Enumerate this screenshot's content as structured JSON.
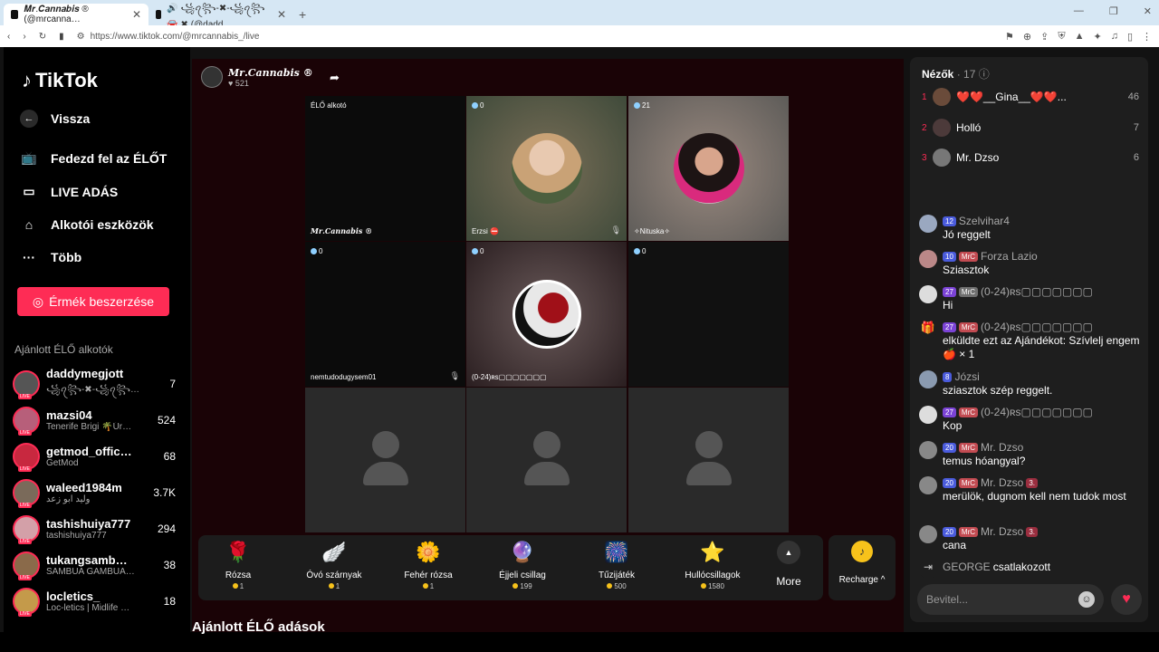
{
  "browser": {
    "tabs": [
      {
        "title": "𝑴𝒓.𝑪𝒂𝒏𝒏𝒂𝒃𝒊𝒔 ® (@mrcanna…",
        "active": true
      },
      {
        "title": "🔊 ꧁ꪖ꧂-✖-꧁ꪖ꧂ 🚘 ✖ (@dadd…",
        "active": false
      }
    ],
    "new_tab": "+",
    "url": "https://www.tiktok.com/@mrcannabis_/live"
  },
  "sidebar": {
    "logo": "TikTok",
    "back": "Vissza",
    "nav": [
      {
        "label": "Fedezd fel az ÉLŐT",
        "icon": "tv-icon"
      },
      {
        "label": "LIVE ADÁS",
        "icon": "camera-icon"
      },
      {
        "label": "Alkotói eszközök",
        "icon": "creator-tools-icon"
      },
      {
        "label": "Több",
        "icon": "more-icon"
      }
    ],
    "coins_button": "Érmék beszerzése",
    "recommended_title": "Ajánlott ÉLŐ alkotók",
    "creators": [
      {
        "name": "daddymegjott",
        "sub": "꧁ꪖ꧂-✖-꧁ꪖ꧂…",
        "count": "7"
      },
      {
        "name": "mazsi04",
        "sub": "Tenerife Brigi 🌴Úr…",
        "count": "524"
      },
      {
        "name": "getmod_offic…",
        "sub": "GetMod",
        "count": "68"
      },
      {
        "name": "waleed1984m",
        "sub": "وليد ابو زعد",
        "count": "3.7K"
      },
      {
        "name": "tashishuiya777",
        "sub": "tashishuiya777",
        "count": "294"
      },
      {
        "name": "tukangsamb…",
        "sub": "SAMBUA GAMBUA…",
        "count": "38"
      },
      {
        "name": "locletics_",
        "sub": "Loc-letics | Midlife …",
        "count": "18"
      }
    ],
    "live_badge": "LIVE"
  },
  "stream": {
    "host_name": "𝑴𝒓.𝑪𝒂𝒏𝒏𝒂𝒃𝒊𝒔 ®",
    "host_likes": "♥ 521",
    "cells": [
      {
        "badge": "ÉLŐ alkotó",
        "tag": "𝑴𝒓.𝑪𝒂𝒏𝒏𝒂𝒃𝒊𝒔 ®"
      },
      {
        "badge": "0",
        "tag": "Erzsi ⛔"
      },
      {
        "badge": "21",
        "tag": "✧Nituska✧"
      },
      {
        "badge": "0",
        "tag": "nemtudodugysem01"
      },
      {
        "badge": "0",
        "tag": "(0-24)ʀs▢▢▢▢▢▢▢"
      },
      {
        "badge": "0",
        "tag": ""
      }
    ],
    "gifts": [
      {
        "name": "Rózsa",
        "price": "1",
        "icon": "🌹"
      },
      {
        "name": "Óvó szárnyak",
        "price": "1",
        "icon": "🪽"
      },
      {
        "name": "Fehér rózsa",
        "price": "1",
        "icon": "🌼"
      },
      {
        "name": "Éjjeli csillag",
        "price": "199",
        "icon": "🔮"
      },
      {
        "name": "Tűzijáték",
        "price": "500",
        "icon": "🎆"
      },
      {
        "name": "Hullócsillagok",
        "price": "1580",
        "icon": "⭐"
      }
    ],
    "more": "More",
    "recharge": "Recharge ^",
    "recommended_live": "Ajánlott ÉLŐ adások"
  },
  "chat": {
    "viewers_title": "Nézők",
    "viewers_count": "· 17",
    "top_viewers": [
      {
        "rank": "1",
        "name": "❤️❤️__Gina__❤️❤️...",
        "points": "46"
      },
      {
        "rank": "2",
        "name": "Holló",
        "points": "7"
      },
      {
        "rank": "3",
        "name": "Mr. Dzso",
        "points": "6"
      }
    ],
    "messages": [
      {
        "level": "12",
        "fan": "",
        "user": "Szelvihar4",
        "rank": "",
        "text": "Jó reggelt"
      },
      {
        "level": "10",
        "fan": "MrC",
        "user": "Forza Lazio",
        "rank": "",
        "text": "Sziasztok"
      },
      {
        "level": "27",
        "fan": "MrC",
        "user": "(0-24)ʀs▢▢▢▢▢▢▢",
        "rank": "",
        "text": "Hi"
      },
      {
        "level": "27",
        "fan": "MrC",
        "user": "(0-24)ʀs▢▢▢▢▢▢▢",
        "rank": "",
        "text": "elküldte ezt az Ajándékot: Szívlelj engem 🍎 × 1"
      },
      {
        "level": "8",
        "fan": "",
        "user": "Józsi",
        "rank": "",
        "text": "sziasztok szép reggelt."
      },
      {
        "level": "27",
        "fan": "MrC",
        "user": "(0-24)ʀs▢▢▢▢▢▢▢",
        "rank": "",
        "text": "Kop"
      },
      {
        "level": "20",
        "fan": "MrC",
        "user": "Mr. Dzso",
        "rank": "",
        "text": "temus hóangyal?"
      },
      {
        "level": "20",
        "fan": "MrC",
        "user": "Mr. Dzso",
        "rank": "3.",
        "text": "merülök, dugnom kell nem tudok most"
      },
      {
        "level": "20",
        "fan": "MrC",
        "user": "Mr. Dzso",
        "rank": "3.",
        "text": "cana"
      }
    ],
    "join_user": "GEORGE",
    "join_text": "csatlakozott",
    "input_placeholder": "Bevitel..."
  },
  "colors": {
    "accent": "#fe2c55",
    "coin": "#f7c21b",
    "stage_bg": "#1a0306"
  }
}
